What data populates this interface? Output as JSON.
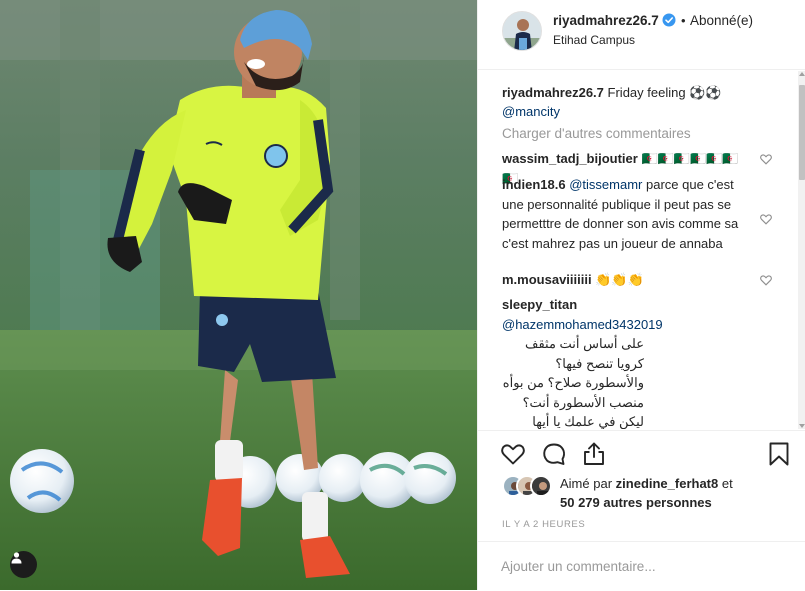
{
  "post": {
    "author": "riyadmahrez26.7",
    "follow_dot": "•",
    "follow_status": "Abonné(e)",
    "location": "Etihad Campus"
  },
  "caption": {
    "user": "riyadmahrez26.7",
    "text": "Friday feeling ⚽️⚽️",
    "mention": "@mancity"
  },
  "load_more": "Charger d'autres commentaires",
  "comments": [
    {
      "user": "wassim_tadj_bijoutier",
      "text": "🇩🇿🇩🇿🇩🇿🇩🇿🇩🇿🇩🇿🇩🇿"
    },
    {
      "user": "indien18.6",
      "mention": "@tissemamr",
      "text": "parce que c'est une personnalité publique il peut pas se permetttre de donner son avis comme sa c'est mahrez pas un joueur de annaba"
    },
    {
      "user": "m.mousaviiiiiii",
      "text": "👏👏👏"
    },
    {
      "user": "sleepy_titan",
      "mention": "@hazemmohamed3432019",
      "text": "على أساس أنت مثقف كرويا تنصح فيها؟ والأسطورة صلاح؟ من بوأه منصب الأسطورة أنت؟ ليكن في علمك يا أيها المثقف كرويا أن تواجد صلاح في المركز الثالث جاء فقط بعد التصويت الكبير الذي نال عليه من طرف الجمهور المصري المنحاز للاعبها وهو أمر مشروع ولكن الذي جعلك تتعرض لصلاح فلا تكن منحازا"
    }
  ],
  "likes": {
    "prefix": "Aimé par",
    "user": "zinedine_ferhat8",
    "middle": "et",
    "count": "50 279 autres personnes"
  },
  "time_ago": "IL Y A 2 HEURES",
  "add_comment": {
    "placeholder": "Ajouter un commentaire..."
  },
  "icons": {
    "like": "heart-icon",
    "comment": "comment-icon",
    "share": "share-icon",
    "save": "bookmark-icon",
    "verified": "verified-badge-icon",
    "tag": "user-tag-icon"
  },
  "colors": {
    "text": "#262626",
    "muted": "#999999",
    "mention": "#003569",
    "verified": "#3897f0",
    "border": "#efefef"
  }
}
